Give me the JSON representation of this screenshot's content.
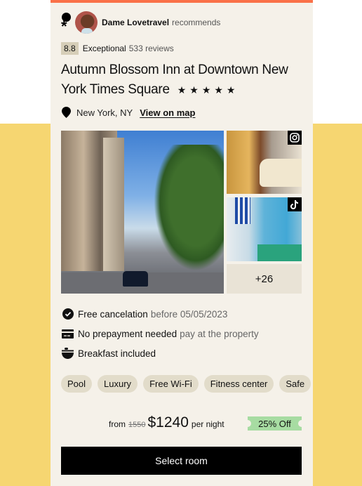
{
  "recommendation": {
    "author": "Dame Lovetravel",
    "verb": "recommends"
  },
  "rating": {
    "score": "8.8",
    "label": "Exceptional",
    "reviews": "533 reviews"
  },
  "hotel": {
    "name": "Autumn Blossom Inn at Downtown New York Times Square",
    "stars": "★★★★★",
    "star_count": 5,
    "location": "New York, NY",
    "map_link": "View on map"
  },
  "gallery": {
    "more_count": "+26",
    "thumbs": [
      {
        "source": "instagram-icon"
      },
      {
        "source": "tiktok-icon"
      }
    ]
  },
  "features": [
    {
      "icon": "check-circle-icon",
      "main": "Free cancelation",
      "sub": "before 05/05/2023"
    },
    {
      "icon": "credit-card-icon",
      "main": "No prepayment needed",
      "sub": "pay at the property"
    },
    {
      "icon": "breakfast-bowl-icon",
      "main": "Breakfast included",
      "sub": ""
    }
  ],
  "amenities": [
    "Pool",
    "Luxury",
    "Free Wi-Fi",
    "Fitness center",
    "Safe"
  ],
  "pricing": {
    "from_label": "from",
    "old_price": "1550",
    "price": "$1240",
    "per_label": "per night",
    "discount": "25% Off"
  },
  "cta": {
    "label": "Select room"
  },
  "colors": {
    "accent_bar": "#fa7148",
    "page_background": "#f6d671",
    "card_background": "#f5f1e9",
    "discount_badge": "#a7dca2",
    "chip": "#e2dcca"
  }
}
